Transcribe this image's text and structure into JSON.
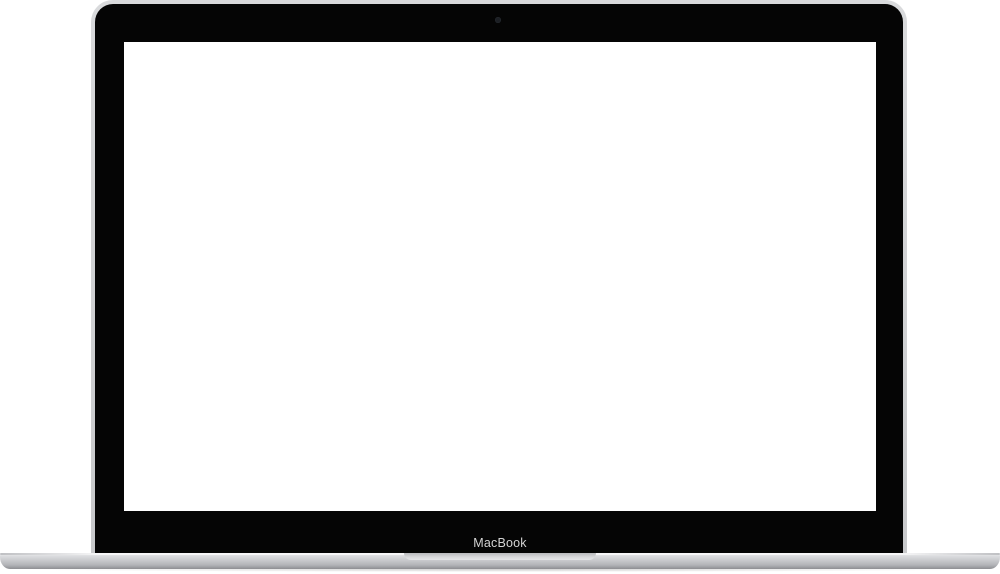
{
  "device": {
    "brand_label": "MacBook",
    "screen_color": "#ffffff",
    "bezel_color": "#050505",
    "body_color": "#c9cacd"
  }
}
